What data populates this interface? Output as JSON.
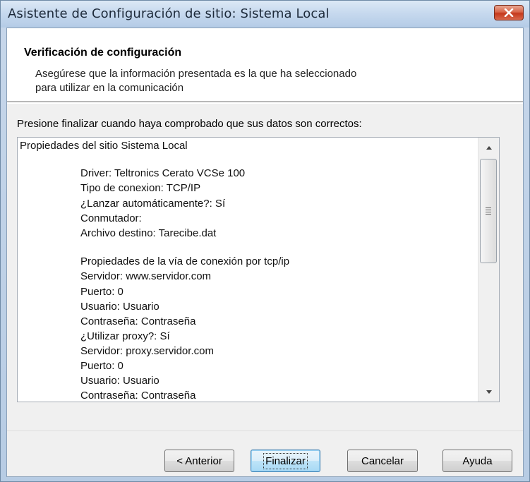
{
  "window": {
    "title": "Asistente de Configuración de sitio: Sistema Local"
  },
  "header": {
    "title": "Verificación de configuración",
    "subtitle_line1": "Asegúrese que la información presentada es la que ha seleccionado",
    "subtitle_line2": "para utilizar en la comunicación"
  },
  "instruction": "Presione finalizar cuando haya comprobado que sus datos son correctos:",
  "summary": {
    "lines": [
      "Propiedades del sitio Sistema Local",
      "Driver: Teltronics Cerato VCSe 100",
      "Tipo de conexion: TCP/IP",
      "¿Lanzar automáticamente?: Sí",
      "Conmutador:",
      "Archivo destino: Tarecibe.dat",
      "Propiedades de la vía de conexión por tcp/ip",
      "Servidor: www.servidor.com",
      "Puerto: 0",
      "Usuario: Usuario",
      "Contraseña: Contraseña",
      "¿Utilizar proxy?: Sí",
      "Servidor: proxy.servidor.com",
      "Puerto: 0",
      "Usuario: Usuario",
      "Contraseña: Contraseña"
    ]
  },
  "buttons": {
    "back": "< Anterior",
    "finish": "Finalizar",
    "cancel": "Cancelar",
    "help": "Ayuda"
  },
  "icons": {
    "close": "close-icon",
    "scroll_up": "scroll-up-arrow-icon",
    "scroll_down": "scroll-down-arrow-icon",
    "grip": "scroll-grip-icon"
  },
  "colors": {
    "close_button": "#c5391c",
    "default_button_border": "#3c7fb1",
    "title_bar": "#c5d8ee"
  }
}
